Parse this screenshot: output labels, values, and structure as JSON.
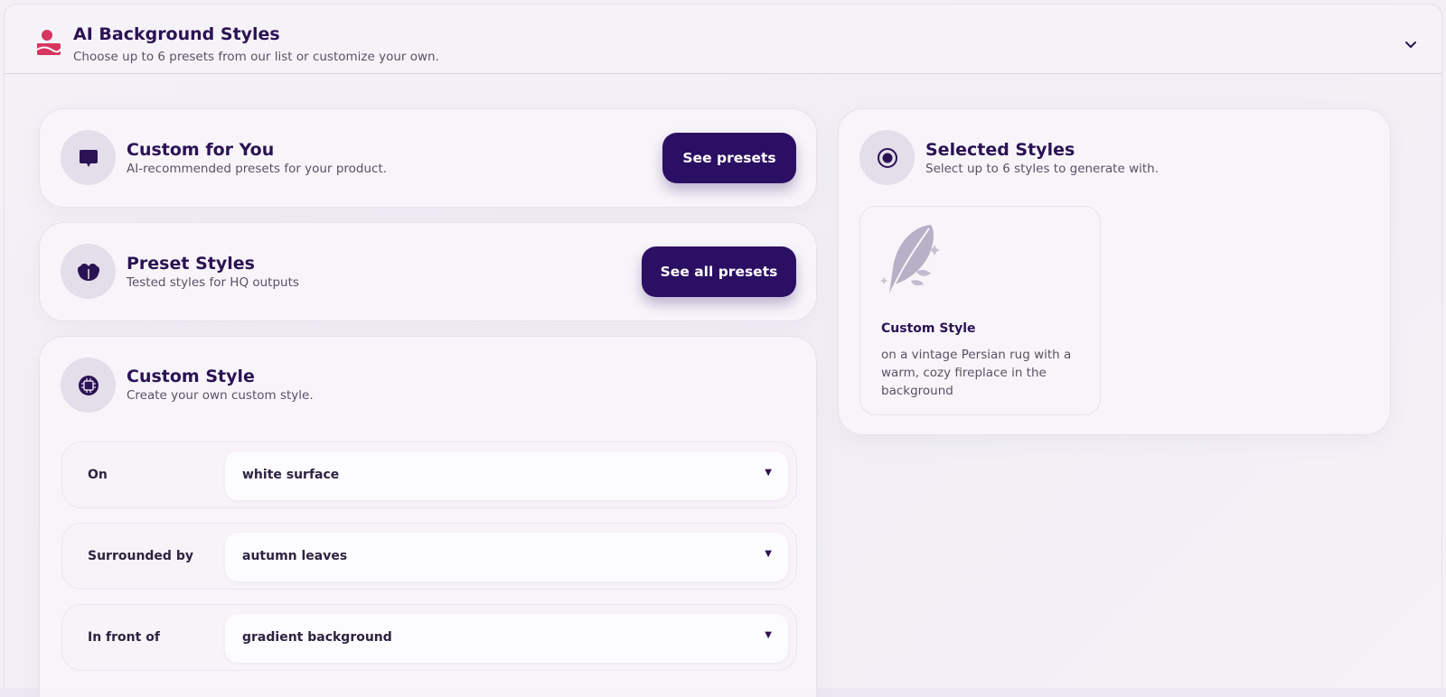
{
  "header": {
    "title": "AI Background Styles",
    "subtitle": "Choose up to 6 presets from our list or customize your own."
  },
  "custom_for_you": {
    "title": "Custom for You",
    "subtitle": "AI-recommended presets for your product.",
    "button": "See presets"
  },
  "preset_styles": {
    "title": "Preset Styles",
    "subtitle": "Tested styles for HQ outputs",
    "button": "See all presets"
  },
  "custom_style": {
    "title": "Custom Style",
    "subtitle": "Create your own custom style.",
    "rows": [
      {
        "label": "On",
        "value": "white surface"
      },
      {
        "label": "Surrounded by",
        "value": "autumn leaves"
      },
      {
        "label": "In front of",
        "value": "gradient background"
      }
    ]
  },
  "selected_styles": {
    "title": "Selected Styles",
    "subtitle": "Select up to 6 styles to generate with.",
    "items": [
      {
        "name": "Custom Style",
        "description": "on a vintage Persian rug with a warm, cozy fireplace in the background"
      }
    ]
  },
  "colors": {
    "accent": "#2b0f63",
    "brand_icon": "#d6365f",
    "heading": "#2b1254"
  },
  "icons": {
    "header": "person-image-icon",
    "custom_for_you": "chat-bubble-icon",
    "preset_styles": "flower-icon",
    "custom_style": "chip-settings-icon",
    "selected_styles": "radio-target-icon",
    "tile": "feather-icon",
    "collapse": "chevron-down-icon"
  }
}
